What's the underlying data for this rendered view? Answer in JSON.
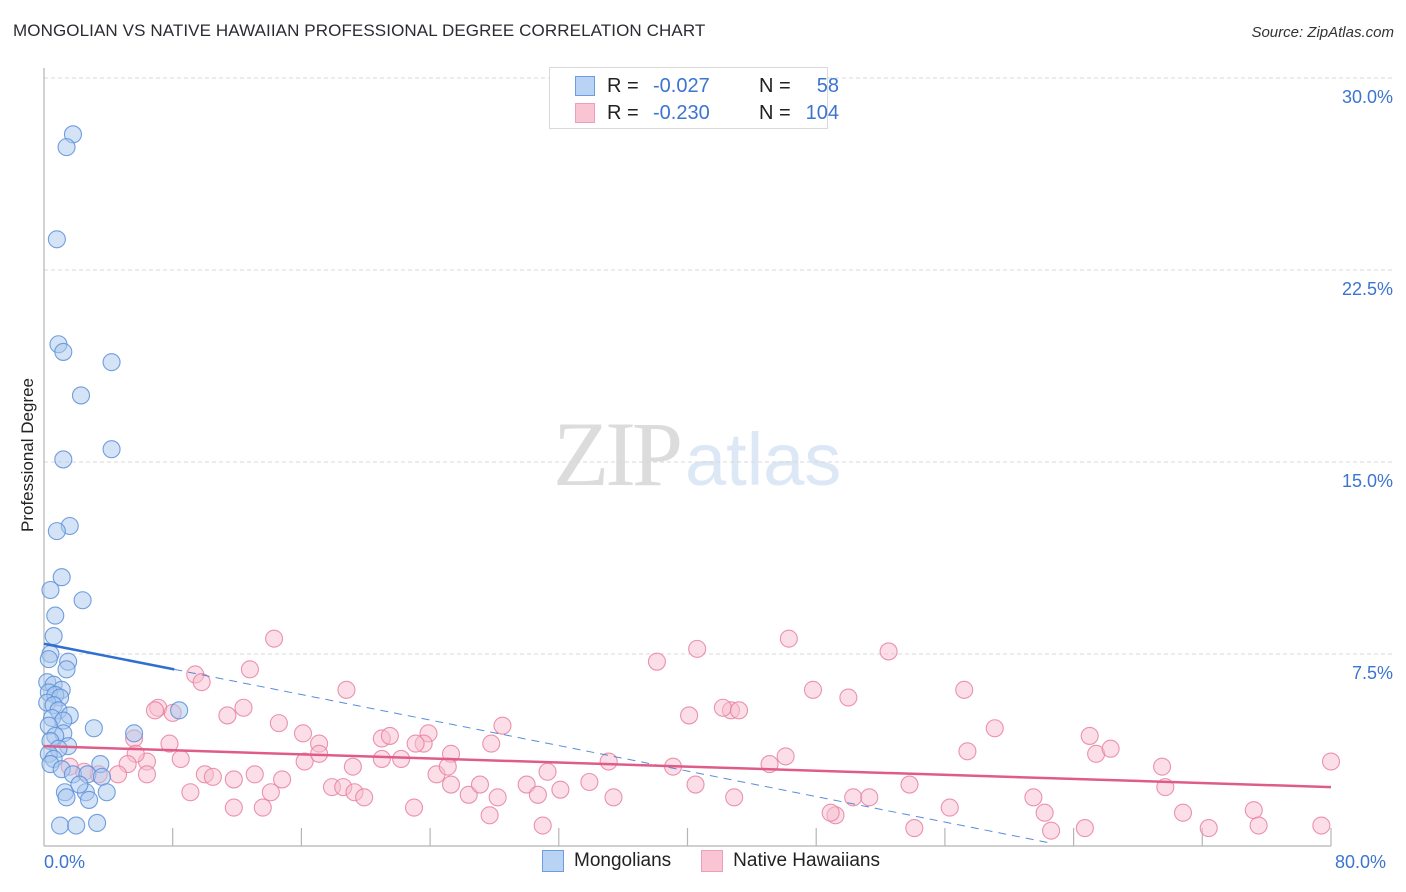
{
  "header": {
    "title": "MONGOLIAN VS NATIVE HAWAIIAN PROFESSIONAL DEGREE CORRELATION CHART",
    "source": "Source: ZipAtlas.com"
  },
  "watermark": {
    "zip": "ZIP",
    "atlas": "atlas"
  },
  "colors": {
    "blue_fill": "#a9c8ee",
    "blue_stroke": "#5b8fd9",
    "blue_line": "#2f6fd0",
    "pink_fill": "#f7bdd0",
    "pink_stroke": "#e8819f",
    "pink_line": "#e05c88",
    "tick_text": "#3c74d0"
  },
  "legend_top": {
    "rows": [
      {
        "series": "Mongolians",
        "r_label": "R =",
        "r_value": "-0.027",
        "n_label": "N =",
        "n_value": "58"
      },
      {
        "series": "Native Hawaiians",
        "r_label": "R =",
        "r_value": "-0.230",
        "n_label": "N =",
        "n_value": "104"
      }
    ]
  },
  "legend_bottom": [
    "Mongolians",
    "Native Hawaiians"
  ],
  "chart_data": {
    "type": "scatter",
    "title": "MONGOLIAN VS NATIVE HAWAIIAN PROFESSIONAL DEGREE CORRELATION CHART",
    "xlabel": "",
    "ylabel": "Professional Degree",
    "xlim": [
      0,
      80
    ],
    "ylim": [
      0,
      30
    ],
    "x_tick_labels": [
      "0.0%",
      "80.0%"
    ],
    "y_tick_labels": [
      "30.0%",
      "22.5%",
      "15.0%",
      "7.5%"
    ],
    "y_ticks": [
      30,
      22.5,
      15,
      7.5
    ],
    "grid": "horizontal-dashed",
    "legend_position": "top-center and bottom",
    "series": [
      {
        "name": "Mongolians",
        "R": -0.027,
        "N": 58,
        "trend": {
          "x0": 0,
          "y0": 7.9,
          "x_solid_end": 8.1,
          "y_solid_end": 6.9,
          "x1": 62.7,
          "y1": 0.1
        },
        "points": [
          [
            1.8,
            27.8
          ],
          [
            1.4,
            27.3
          ],
          [
            0.8,
            23.7
          ],
          [
            0.9,
            19.6
          ],
          [
            1.2,
            19.3
          ],
          [
            4.2,
            18.9
          ],
          [
            2.3,
            17.6
          ],
          [
            4.2,
            15.5
          ],
          [
            1.2,
            15.1
          ],
          [
            1.6,
            12.5
          ],
          [
            0.8,
            12.3
          ],
          [
            1.1,
            10.5
          ],
          [
            0.4,
            10.0
          ],
          [
            2.4,
            9.6
          ],
          [
            0.7,
            9.0
          ],
          [
            0.6,
            8.2
          ],
          [
            0.4,
            7.5
          ],
          [
            0.3,
            7.3
          ],
          [
            1.5,
            7.2
          ],
          [
            1.4,
            6.9
          ],
          [
            0.2,
            6.4
          ],
          [
            0.6,
            6.3
          ],
          [
            1.1,
            6.1
          ],
          [
            0.3,
            6.0
          ],
          [
            0.7,
            5.9
          ],
          [
            1.0,
            5.8
          ],
          [
            0.2,
            5.6
          ],
          [
            0.6,
            5.5
          ],
          [
            0.9,
            5.3
          ],
          [
            8.4,
            5.3
          ],
          [
            1.6,
            5.1
          ],
          [
            0.5,
            5.0
          ],
          [
            1.2,
            4.9
          ],
          [
            0.3,
            4.7
          ],
          [
            3.1,
            4.6
          ],
          [
            1.2,
            4.4
          ],
          [
            0.7,
            4.3
          ],
          [
            5.6,
            4.4
          ],
          [
            0.4,
            4.1
          ],
          [
            1.5,
            3.9
          ],
          [
            0.9,
            3.8
          ],
          [
            0.3,
            3.6
          ],
          [
            0.6,
            3.4
          ],
          [
            3.5,
            3.2
          ],
          [
            0.4,
            3.2
          ],
          [
            1.1,
            3.0
          ],
          [
            1.8,
            2.8
          ],
          [
            2.7,
            2.8
          ],
          [
            3.6,
            2.7
          ],
          [
            1.3,
            2.1
          ],
          [
            2.6,
            2.1
          ],
          [
            1.4,
            1.9
          ],
          [
            3.9,
            2.1
          ],
          [
            2.8,
            1.8
          ],
          [
            1.0,
            0.8
          ],
          [
            2.0,
            0.8
          ],
          [
            3.3,
            0.9
          ],
          [
            2.2,
            2.4
          ]
        ]
      },
      {
        "name": "Native Hawaiians",
        "R": -0.23,
        "N": 104,
        "trend": {
          "x0": 0,
          "y0": 3.9,
          "x1": 80,
          "y1": 2.3
        },
        "points": [
          [
            14.3,
            8.1
          ],
          [
            9.4,
            6.7
          ],
          [
            9.8,
            6.4
          ],
          [
            12.8,
            6.9
          ],
          [
            18.8,
            6.1
          ],
          [
            12.4,
            5.4
          ],
          [
            7.1,
            5.4
          ],
          [
            11.4,
            5.1
          ],
          [
            14.6,
            4.8
          ],
          [
            8.0,
            5.2
          ],
          [
            6.9,
            5.3
          ],
          [
            5.6,
            4.2
          ],
          [
            7.8,
            4.0
          ],
          [
            16.1,
            4.4
          ],
          [
            17.1,
            4.0
          ],
          [
            21.0,
            4.2
          ],
          [
            21.5,
            4.3
          ],
          [
            23.9,
            4.4
          ],
          [
            23.6,
            4.0
          ],
          [
            23.1,
            4.0
          ],
          [
            25.3,
            3.6
          ],
          [
            27.8,
            4.0
          ],
          [
            28.5,
            4.7
          ],
          [
            22.2,
            3.4
          ],
          [
            21.0,
            3.4
          ],
          [
            19.2,
            3.1
          ],
          [
            16.2,
            3.3
          ],
          [
            17.1,
            3.6
          ],
          [
            14.8,
            2.6
          ],
          [
            13.1,
            2.8
          ],
          [
            10.0,
            2.8
          ],
          [
            10.5,
            2.7
          ],
          [
            8.5,
            3.4
          ],
          [
            6.4,
            3.3
          ],
          [
            5.7,
            3.6
          ],
          [
            5.2,
            3.2
          ],
          [
            3.4,
            2.8
          ],
          [
            2.5,
            2.9
          ],
          [
            1.6,
            3.1
          ],
          [
            4.6,
            2.8
          ],
          [
            6.4,
            2.8
          ],
          [
            9.1,
            2.1
          ],
          [
            11.8,
            2.6
          ],
          [
            14.1,
            2.1
          ],
          [
            13.6,
            1.5
          ],
          [
            11.8,
            1.5
          ],
          [
            17.9,
            2.3
          ],
          [
            18.6,
            2.3
          ],
          [
            19.3,
            2.1
          ],
          [
            19.9,
            1.9
          ],
          [
            23.0,
            1.5
          ],
          [
            24.4,
            2.8
          ],
          [
            25.1,
            3.1
          ],
          [
            25.3,
            2.4
          ],
          [
            26.4,
            2.0
          ],
          [
            27.1,
            2.4
          ],
          [
            28.2,
            1.9
          ],
          [
            27.7,
            1.2
          ],
          [
            30.0,
            2.4
          ],
          [
            30.7,
            2.0
          ],
          [
            31.3,
            2.9
          ],
          [
            32.1,
            2.2
          ],
          [
            31.0,
            0.8
          ],
          [
            33.9,
            2.5
          ],
          [
            35.1,
            3.3
          ],
          [
            35.4,
            1.9
          ],
          [
            39.1,
            3.1
          ],
          [
            40.5,
            2.4
          ],
          [
            40.1,
            5.1
          ],
          [
            38.1,
            7.2
          ],
          [
            40.6,
            7.7
          ],
          [
            42.7,
            5.3
          ],
          [
            42.2,
            5.4
          ],
          [
            42.9,
            1.9
          ],
          [
            45.1,
            3.2
          ],
          [
            43.2,
            5.3
          ],
          [
            46.1,
            3.5
          ],
          [
            46.3,
            8.1
          ],
          [
            47.8,
            6.1
          ],
          [
            49.2,
            1.2
          ],
          [
            48.9,
            1.3
          ],
          [
            50.3,
            1.9
          ],
          [
            51.3,
            1.9
          ],
          [
            50.0,
            5.8
          ],
          [
            52.5,
            7.6
          ],
          [
            54.1,
            0.7
          ],
          [
            56.3,
            1.5
          ],
          [
            57.2,
            6.1
          ],
          [
            57.4,
            3.7
          ],
          [
            53.8,
            2.4
          ],
          [
            59.1,
            4.6
          ],
          [
            61.5,
            1.9
          ],
          [
            62.2,
            1.3
          ],
          [
            62.6,
            0.6
          ],
          [
            65.0,
            4.3
          ],
          [
            65.4,
            3.6
          ],
          [
            66.3,
            3.8
          ],
          [
            64.7,
            0.7
          ],
          [
            69.5,
            3.1
          ],
          [
            69.7,
            2.3
          ],
          [
            70.8,
            1.3
          ],
          [
            72.4,
            0.7
          ],
          [
            75.2,
            1.4
          ],
          [
            80.0,
            3.3
          ],
          [
            75.5,
            0.8
          ],
          [
            79.4,
            0.8
          ]
        ]
      }
    ]
  }
}
